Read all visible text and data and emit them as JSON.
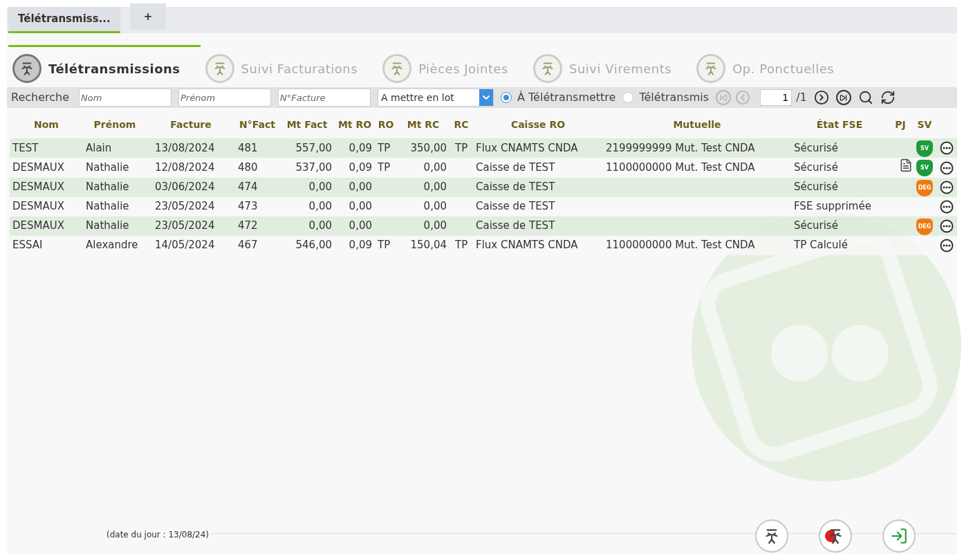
{
  "tabs": [
    {
      "label": "Télétransmiss...",
      "selected": true
    },
    {
      "label": "+",
      "selected": false
    }
  ],
  "sections": [
    {
      "label": "Télétransmissions",
      "selected": true
    },
    {
      "label": "Suivi Facturations",
      "selected": false
    },
    {
      "label": "Pièces Jointes",
      "selected": false
    },
    {
      "label": "Suivi Virements",
      "selected": false
    },
    {
      "label": "Op. Ponctuelles",
      "selected": false
    }
  ],
  "search": {
    "label": "Recherche",
    "fields": [
      {
        "placeholder": "Nom"
      },
      {
        "placeholder": "Prénom"
      },
      {
        "placeholder": "N°Facture"
      }
    ],
    "lot_select": {
      "value": "A mettre en lot"
    },
    "radios": [
      {
        "label": "À Télétransmettre",
        "selected": true
      },
      {
        "label": "Télétransmis",
        "selected": false
      }
    ],
    "pager": [
      {
        "kind": "first",
        "disabled": true
      },
      {
        "kind": "prev",
        "disabled": true
      }
    ],
    "page": "1",
    "page_total": "/1",
    "actions": [
      {
        "kind": "next",
        "disabled": false
      },
      {
        "kind": "last",
        "disabled": false
      },
      {
        "kind": "search",
        "disabled": false
      },
      {
        "kind": "refresh",
        "disabled": false
      }
    ]
  },
  "table": {
    "columns": [
      "Nom",
      "Prénom",
      "Facture",
      "N°Fact",
      "Mt Fact",
      "Mt RO",
      "RO",
      "Mt RC",
      "RC",
      "Caisse RO",
      "Mutuelle",
      "État FSE",
      "PJ",
      "SV"
    ],
    "rows": [
      {
        "cells": [
          "TEST",
          "Alain",
          "13/08/2024",
          "481",
          "557,00",
          "0,09",
          "TP",
          "350,00",
          "TP",
          "Flux CNAMTS CNDA",
          "2199999999 Mut. Test CNDA",
          "Sécurisé"
        ],
        "pj": false,
        "sv": {
          "kind": "sv",
          "label": "SV"
        }
      },
      {
        "cells": [
          "DESMAUX",
          "Nathalie",
          "12/08/2024",
          "480",
          "537,00",
          "0,09",
          "TP",
          "0,00",
          "",
          "Caisse de TEST",
          "1100000000 Mut. Test CNDA",
          "Sécurisé"
        ],
        "pj": true,
        "sv": {
          "kind": "sv",
          "label": "SV"
        }
      },
      {
        "cells": [
          "DESMAUX",
          "Nathalie",
          "03/06/2024",
          "474",
          "0,00",
          "0,00",
          "",
          "0,00",
          "",
          "Caisse de TEST",
          "",
          "Sécurisé"
        ],
        "pj": false,
        "sv": {
          "kind": "deg",
          "label": "DEG"
        }
      },
      {
        "cells": [
          "DESMAUX",
          "Nathalie",
          "23/05/2024",
          "473",
          "0,00",
          "0,00",
          "",
          "0,00",
          "",
          "Caisse de TEST",
          "",
          "FSE supprimée"
        ],
        "pj": false,
        "sv": null
      },
      {
        "cells": [
          "DESMAUX",
          "Nathalie",
          "23/05/2024",
          "472",
          "0,00",
          "0,00",
          "",
          "0,00",
          "",
          "Caisse de TEST",
          "",
          "Sécurisé"
        ],
        "pj": false,
        "sv": {
          "kind": "deg",
          "label": "DEG"
        }
      },
      {
        "cells": [
          "ESSAI",
          "Alexandre",
          "14/05/2024",
          "467",
          "546,00",
          "0,09",
          "TP",
          "150,04",
          "TP",
          "Flux CNAMTS CNDA",
          "1100000000 Mut. Test CNDA",
          "TP Calculé"
        ],
        "pj": false,
        "sv": null
      }
    ]
  },
  "footer": {
    "date": "(date du jour : 13/08/24)",
    "buttons": [
      {
        "kind": "send"
      },
      {
        "kind": "cancel-send"
      },
      {
        "kind": "exit"
      }
    ]
  }
}
